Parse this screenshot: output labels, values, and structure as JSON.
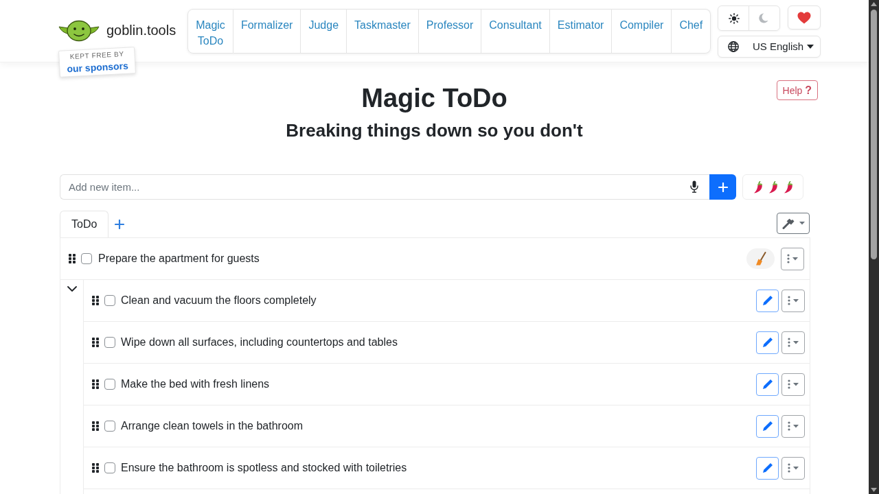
{
  "header": {
    "site_name": "goblin.tools",
    "sponsor": {
      "tagline": "KEPT FREE BY",
      "link": "our sponsors"
    },
    "nav": [
      {
        "label": "Magic ToDo"
      },
      {
        "label": "Formalizer"
      },
      {
        "label": "Judge"
      },
      {
        "label": "Taskmaster"
      },
      {
        "label": "Professor"
      },
      {
        "label": "Consultant"
      },
      {
        "label": "Estimator"
      },
      {
        "label": "Compiler"
      },
      {
        "label": "Chef"
      }
    ],
    "theme": [
      {
        "kind": "light",
        "selected": true
      },
      {
        "kind": "dark",
        "selected": false
      }
    ],
    "language": "US English"
  },
  "help_button": {
    "label": "Help",
    "symbol": "?"
  },
  "title": "Magic ToDo",
  "subtitle": "Breaking things down so you don't",
  "new_item": {
    "placeholder": "Add new item..."
  },
  "tabs": [
    {
      "label": "ToDo",
      "selected": true
    }
  ],
  "tasks": [
    {
      "text": "Prepare the apartment for guests",
      "checked": false,
      "expanded": true,
      "children": [
        {
          "text": "Clean and vacuum the floors completely",
          "checked": false
        },
        {
          "text": "Wipe down all surfaces, including countertops and tables",
          "checked": false
        },
        {
          "text": "Make the bed with fresh linens",
          "checked": false
        },
        {
          "text": "Arrange clean towels in the bathroom",
          "checked": false
        },
        {
          "text": "Ensure the bathroom is spotless and stocked with toiletries",
          "checked": false
        }
      ]
    }
  ]
}
